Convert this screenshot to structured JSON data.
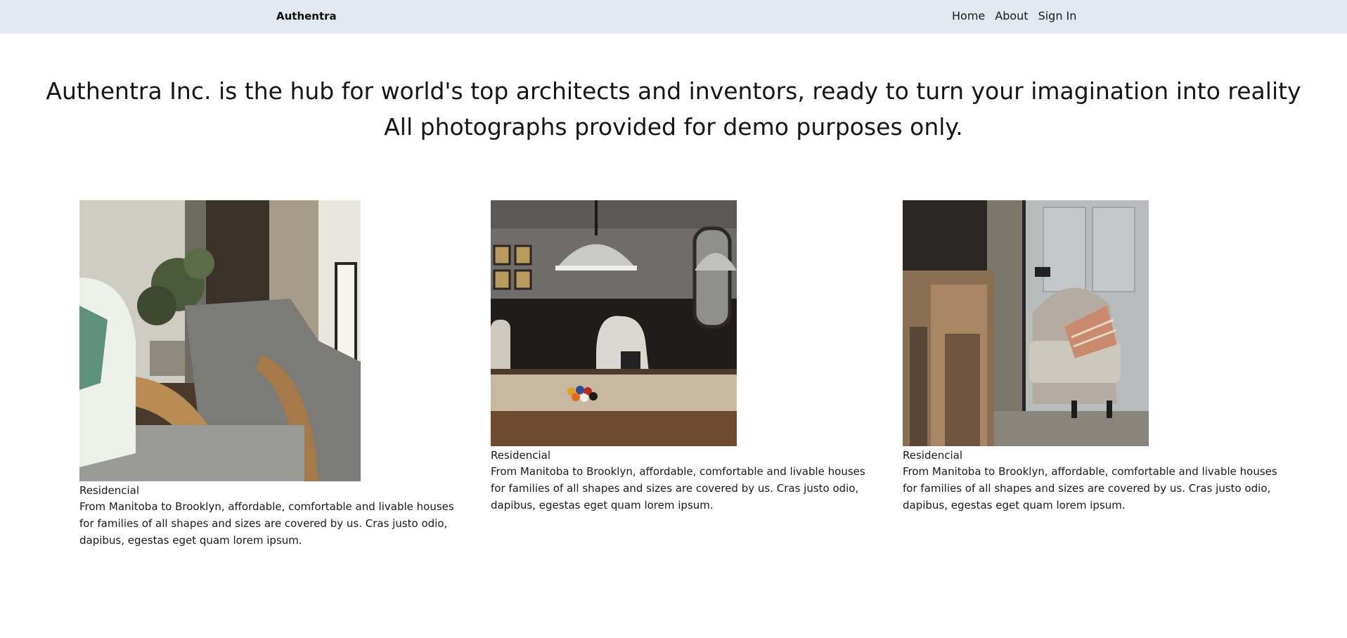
{
  "navbar": {
    "brand": "Authentra",
    "links": [
      {
        "label": "Home"
      },
      {
        "label": "About"
      },
      {
        "label": "Sign In"
      }
    ]
  },
  "hero": {
    "line1": "Authentra Inc. is the hub for world's top architects and inventors, ready to turn your imagination into reality",
    "line2": "All photographs provided for demo purposes only."
  },
  "cards": [
    {
      "title": "Residencial",
      "text": "From Manitoba to Brooklyn, affordable, comfortable and livable houses for families of all shapes and sizes are covered by us. Cras justo odio, dapibus, egestas eget quam lorem ipsum."
    },
    {
      "title": "Residencial",
      "text": "From Manitoba to Brooklyn, affordable, comfortable and livable houses for families of all shapes and sizes are covered by us. Cras justo odio, dapibus, egestas eget quam lorem ipsum."
    },
    {
      "title": "Residencial",
      "text": "From Manitoba to Brooklyn, affordable, comfortable and livable houses for families of all shapes and sizes are covered by us. Cras justo odio, dapibus, egestas eget quam lorem ipsum."
    }
  ]
}
